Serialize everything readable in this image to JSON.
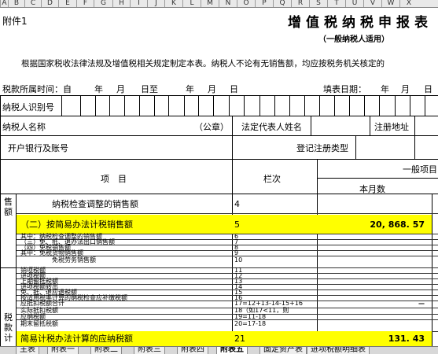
{
  "column_headers": [
    "A",
    "B",
    "C",
    "D",
    "E",
    "F",
    "G",
    "H",
    "I",
    "J",
    "K",
    "L",
    "M",
    "N",
    "O",
    "P",
    "Q",
    "R",
    "S",
    "T",
    "U",
    "V",
    "W",
    "X"
  ],
  "doc": {
    "attachment": "附件1",
    "title": "增值税纳税申报表",
    "subtitle": "（一般纳税人适用）",
    "intro": "根据国家税收法律法规及增值税相关规定制定本表。纳税人不论有无销售额，均应按税务机关核定的",
    "period_label": "税款所属时间：自",
    "period_year": "年",
    "period_month": "月",
    "period_day_to": "日至",
    "period_year2": "年",
    "period_month2": "月",
    "period_day": "日",
    "fill_date_label": "填表日期：",
    "fill_year": "年",
    "fill_month": "月",
    "fill_day": "日",
    "taxpayer_id_label": "纳税人识别号",
    "taxpayer_name_label": "纳税人名称",
    "seal_label": "（公章）",
    "legal_rep_label": "法定代表人姓名",
    "reg_address_label": "注册地址",
    "bank_label": "开户银行及账号",
    "reg_type_label": "登记注册类型"
  },
  "table": {
    "col_item": "项　目",
    "col_line": "栏次",
    "col_general": "一般项目",
    "col_current_month": "本月数",
    "section_sales": "售额",
    "section_tax": "税款计",
    "rows": [
      {
        "label": "纳税检查调整的销售额",
        "line": "4",
        "value": ""
      },
      {
        "label": "（二）按简易办法计税销售额",
        "line": "5",
        "value": "20, 868. 57"
      },
      {
        "label": "其中：纳税检查调整的销售额",
        "line": "6",
        "value": ""
      },
      {
        "label": "（三）免、抵、退办法出口销售额",
        "line": "7",
        "value": ""
      },
      {
        "label": "（四）免税销售额",
        "line": "8",
        "value": ""
      },
      {
        "label": "其中：免税货物销售额",
        "line": "9",
        "value": ""
      },
      {
        "label": "免税劳务销售额",
        "line": "10",
        "value": ""
      },
      {
        "label": "销项税额",
        "line": "11",
        "value": ""
      },
      {
        "label": "进项税额",
        "line": "12",
        "value": ""
      },
      {
        "label": "上期留抵税额",
        "line": "13",
        "value": ""
      },
      {
        "label": "进项税额转出",
        "line": "14",
        "value": ""
      },
      {
        "label": "免、抵、退应退税额",
        "line": "15",
        "value": ""
      },
      {
        "label": "按适用税率计算的纳税检查应补缴税额",
        "line": "16",
        "value": ""
      },
      {
        "label": "应抵扣税额合计",
        "line": "17=12+13-14-15+16",
        "value": "—"
      },
      {
        "label": "实际抵扣税额",
        "line": "18（如17<11，则",
        "value": ""
      },
      {
        "label": "应纳税额",
        "line": "19=11-18",
        "value": ""
      },
      {
        "label": "期末留抵税额",
        "line": "20=17-18",
        "value": ""
      },
      {
        "label": "简易计税办法计算的应纳税额",
        "line": "21",
        "value": "131. 43"
      }
    ]
  },
  "sheet_tabs": [
    "主表",
    "附表一",
    "附表二",
    "附表三",
    "附表四",
    "附表五",
    "固定资产表",
    "进项税额明细表"
  ],
  "active_tab": "附表五",
  "colors": {
    "highlight": "#ffff00",
    "header_bg": "#e9e9e9"
  }
}
